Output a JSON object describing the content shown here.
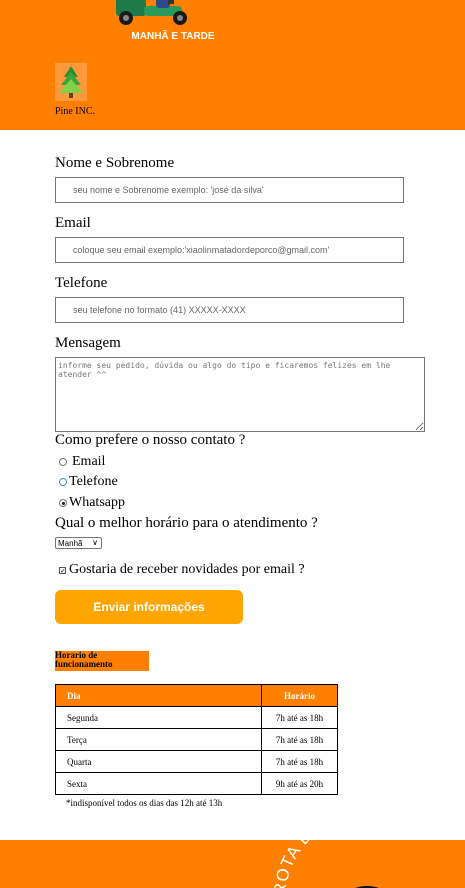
{
  "header": {
    "banner_text": "MANHÃ E TARDE",
    "company_name": "Pine INC."
  },
  "form": {
    "name": {
      "label": "Nome e Sobrenome",
      "placeholder": "seu nome e Sobrenome exemplo: 'josé da silva'"
    },
    "email": {
      "label": "Email",
      "placeholder": "coloque seu email exemplo:'xiaolinmatadordeporco@gmail.com'"
    },
    "phone": {
      "label": "Telefone",
      "placeholder": "seu telefone no formato (41) XXXXX-XXXX"
    },
    "message": {
      "label": "Mensagem",
      "placeholder": "informe seu pedido, dúvida ou algo do tipo e ficaremos felizes em lhe atender ^^"
    },
    "contact_question": "Como prefere o nosso contato ?",
    "contact_options": [
      "Email",
      "Telefone",
      "Whatsapp"
    ],
    "contact_selected": "Whatsapp",
    "time_question": "Qual o melhor horário para o atendimento ?",
    "time_selected": "Manhã",
    "newsletter_label": "Gostaria de receber novidades por email ?",
    "newsletter_checked": true,
    "submit_label": "Enviar informações"
  },
  "schedule": {
    "title": "Horario de funcionamento",
    "headers": [
      "Dia",
      "Horário"
    ],
    "rows": [
      [
        "Segunda",
        "7h até as 18h"
      ],
      [
        "Terça",
        "7h até as 18h"
      ],
      [
        "Quarta",
        "7h até as 18h"
      ],
      [
        "Sexta",
        "9h até as 20h"
      ]
    ],
    "note": "*indisponível todos os dias das 12h até 13h"
  },
  "footer": {
    "logo_text": "ROTA DO LANCHE"
  },
  "colors": {
    "brand_orange": "#ff8000",
    "button_orange": "#ffa500"
  }
}
